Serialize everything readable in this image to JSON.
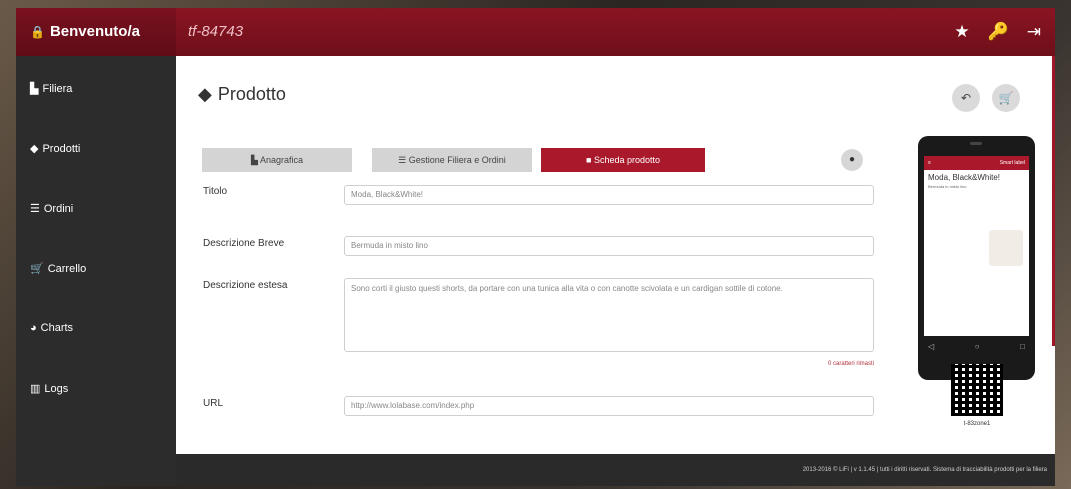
{
  "header": {
    "brand": "Benvenuto/a",
    "code": "tf-84743",
    "icons": [
      "star-icon",
      "key-icon",
      "logout-icon"
    ]
  },
  "sidebar": {
    "items": [
      {
        "label": "Filiera",
        "icon": "factory-icon"
      },
      {
        "label": "Prodotti",
        "icon": "tag-icon"
      },
      {
        "label": "Ordini",
        "icon": "list-icon"
      },
      {
        "label": "Carrello",
        "icon": "cart-icon"
      },
      {
        "label": "Charts",
        "icon": "pie-icon"
      },
      {
        "label": "Logs",
        "icon": "bar-chart-icon"
      }
    ]
  },
  "page": {
    "title": "Prodotto",
    "tabs": [
      {
        "label": "Anagrafica",
        "active": false
      },
      {
        "label": "Gestione Filiera e Ordini",
        "active": false
      },
      {
        "label": "Scheda prodotto",
        "active": true
      }
    ]
  },
  "form": {
    "titolo_label": "Titolo",
    "titolo_value": "Moda, Black&White!",
    "breve_label": "Descrizione Breve",
    "breve_value": "Bermuda in misto lino",
    "estesa_label": "Descrizione estesa",
    "estesa_value": "Sono corti il giusto questi shorts, da portare con una tunica alla vita o con canotte scivolata e un cardigan sottile di cotone.",
    "counter": "0 caratteri rimasti",
    "url_label": "URL",
    "url_value": "http://www.lolabase.com/index.php"
  },
  "preview": {
    "bar_left": "≡",
    "bar_right": "Smart label",
    "title": "Moda, Black&White!",
    "short_desc": "Bermuda in misto lino",
    "caption": "t-83zone1"
  },
  "footer": {
    "text": "2013-2016 © LiFi | v 1.1.45 | tutti i diritti riservati. Sistema di tracciabilità prodotti per la filiera"
  },
  "colors": {
    "accent": "#a9192b",
    "sidebar": "#2c2c2c",
    "topbar": "#7a1120"
  }
}
